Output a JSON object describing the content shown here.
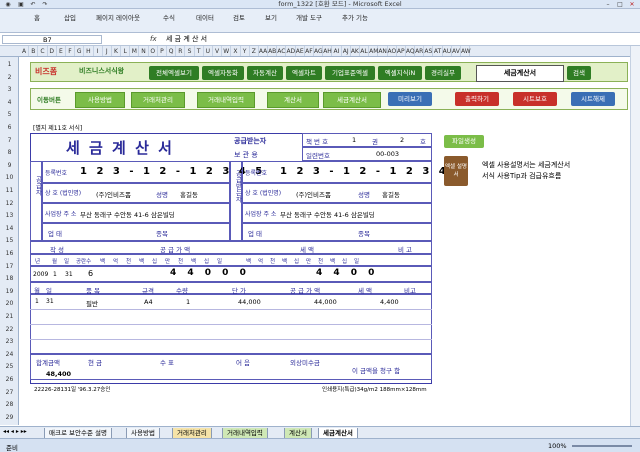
{
  "window": {
    "title": "form_1322  [호환 모드] - Microsoft Excel"
  },
  "ribbon": {
    "tabs": [
      "홈",
      "삽입",
      "페이지 레이아웃",
      "수식",
      "데이터",
      "검토",
      "보기",
      "개발 도구",
      "추가 기능"
    ]
  },
  "formula_bar": {
    "cell_ref": "B7",
    "fx": "fx",
    "value": "세 금 계 산 서"
  },
  "columns": [
    "A",
    "B",
    "C",
    "D",
    "E",
    "F",
    "G",
    "H",
    "I",
    "J",
    "K",
    "L",
    "M",
    "N",
    "O",
    "P",
    "Q",
    "R",
    "S",
    "T",
    "U",
    "V",
    "W",
    "X",
    "Y",
    "Z",
    "AA",
    "AB",
    "AC",
    "AD",
    "AE",
    "AF",
    "AG",
    "AH",
    "AI",
    "AJ",
    "AK",
    "AL",
    "AM",
    "AN",
    "AO",
    "AP",
    "AQ",
    "AR",
    "AS",
    "AT",
    "AU",
    "AV",
    "AW"
  ],
  "rows": [
    "1",
    "2",
    "3",
    "4",
    "5",
    "6",
    "7",
    "8",
    "9",
    "10",
    "11",
    "12",
    "13",
    "14",
    "15",
    "16",
    "17",
    "18",
    "19",
    "20",
    "21",
    "22",
    "23",
    "24",
    "25",
    "26",
    "27",
    "28",
    "29"
  ],
  "topbar": {
    "logo1": "비즈폼",
    "logo2": "비즈니스서식왕",
    "menus": [
      "전체엑셀보기",
      "엑셀자동화",
      "자동계산",
      "엑셀차트",
      "기업표준엑셀",
      "엑셀지식iN",
      "경리실무"
    ],
    "selected": "세금계산서",
    "search": "검색"
  },
  "navbar": {
    "label": "이동버튼",
    "buttons": [
      "사용방법",
      "거래처관리",
      "거래내역입력",
      "계산서",
      "세금계산서"
    ],
    "actions": [
      "미리보기",
      "출력하기",
      "시트보호",
      "시트해제"
    ]
  },
  "invoice": {
    "form_no": "[별지 제11호 서식]",
    "title": "세 금 계 산 서",
    "copy_type": "공급받는자",
    "copy_type2": "보 관 용",
    "book_no_label": "책 번 호",
    "book_no_1": "1",
    "book_no_vol": "권",
    "book_no_2": "2",
    "book_no_ho": "호",
    "serial_label": "일련번호",
    "serial": "00-003",
    "supplier_side": "공급자",
    "receiver_side": "공급받는자",
    "reg_label": "등록번호",
    "supplier_reg": "1 2 3 - 1 2 - 1 2 3 4 5",
    "receiver_reg": "1 2 3 - 1 2 - 1 2 3 4 5",
    "company_label": "상 호 (법인명)",
    "supplier_company": "(주)인비즈폼",
    "receiver_company": "(주)인비즈폼",
    "name_label": "성명",
    "supplier_name": "홍길동",
    "receiver_name": "홍길동",
    "addr_label": "사업장 주 소",
    "supplier_addr": "부산 동래구 수안동 41-6 삼은빌딩",
    "receiver_addr": "부산 동래구 수안동 41-6 삼은빌딩",
    "biz_type_label": "업 태",
    "biz_item_label": "종목",
    "written_label": "작 성",
    "supply_value_label": "공 급 가 액",
    "tax_label": "세 액",
    "note_label": "비 고",
    "date_hdr": [
      "년",
      "월",
      "일",
      "공란수"
    ],
    "digit_hdr": [
      "백",
      "억",
      "천",
      "백",
      "십",
      "만",
      "천",
      "백",
      "십",
      "일"
    ],
    "year": "2009",
    "month": "1",
    "day": "31",
    "blanks": "6",
    "supply_digits": "4 4 0 0 0",
    "tax_digits": "4 4 0 0",
    "items_hdr": [
      "월",
      "일",
      "품 목",
      "규격",
      "수량",
      "단 가",
      "공 급 가 액",
      "세 액",
      "비고"
    ],
    "items": [
      {
        "m": "1",
        "d": "31",
        "item": "필반",
        "spec": "A4",
        "qty": "1",
        "price": "44,000",
        "supply": "44,000",
        "tax": "4,400",
        "note": ""
      }
    ],
    "totals_hdr": [
      "합계금액",
      "현 금",
      "수 표",
      "어 음",
      "외상미수금"
    ],
    "total": "48,400",
    "receipt_text": "이 금액을  청구  함",
    "footer_left": "22226-28131일 '96.3.27승인",
    "footer_right": "인쇄용지(특급)34g/m2 188mm×128mm"
  },
  "side": {
    "file_button": "파일생성",
    "book_label": "엑셀 설명서",
    "desc_line1": "엑셀 사용설명서는 세금계산서",
    "desc_line2": "서식 사용Tip과 검급유흐름"
  },
  "sheet_tabs": [
    "매크로 보안수준 설명",
    "사용방법",
    "거래처관리",
    "거래내역입력",
    "계산서",
    "세금계산서"
  ],
  "status": {
    "left": "준비",
    "zoom": "100%"
  }
}
